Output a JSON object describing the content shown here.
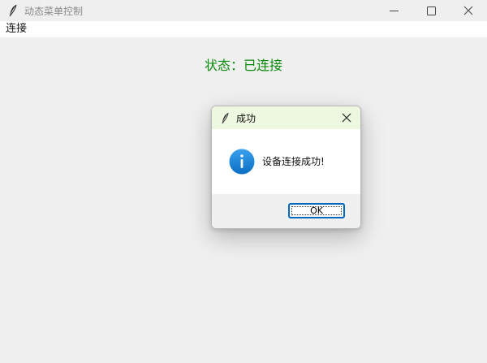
{
  "window": {
    "title": "动态菜单控制",
    "icon": "feather-icon",
    "controls": [
      "minimize-icon",
      "maximize-icon",
      "close-icon"
    ]
  },
  "menubar": {
    "items": [
      {
        "label": "连接"
      }
    ]
  },
  "main": {
    "status_text": "状态：已连接",
    "status_color": "#0a8a0a"
  },
  "dialog": {
    "title": "成功",
    "icon": "feather-icon",
    "message_icon": "info-icon",
    "message": "设备连接成功!",
    "ok_label": "OK",
    "accent_color": "#0067c0"
  }
}
